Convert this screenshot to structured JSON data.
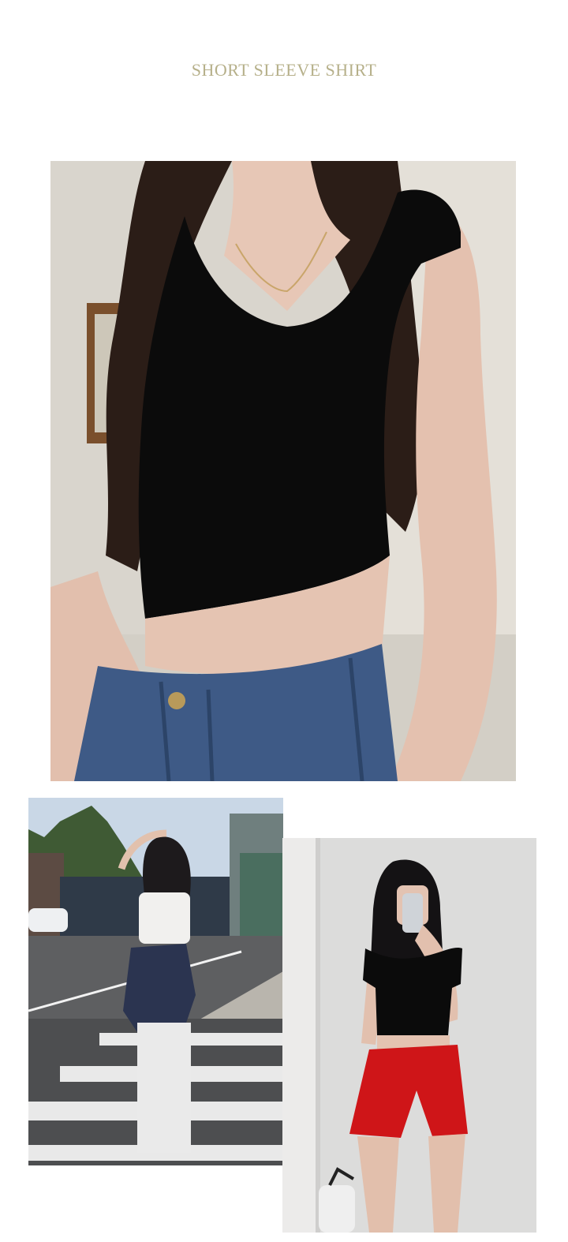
{
  "page": {
    "title": "SHORT SLEEVE SHIRT"
  },
  "colors": {
    "title": "#b6b08a",
    "top_black": "#0b0b0b",
    "denim": "#3e5a86",
    "shorts_red": "#cf1518",
    "sky": "#c9d7e6"
  },
  "images": [
    {
      "name": "main-photo",
      "alt": "model wearing black sleeveless crop top with denim jeans"
    },
    {
      "name": "street-photo",
      "alt": "model in white crop top and white pants on street crosswalk"
    },
    {
      "name": "studio-photo",
      "alt": "model in black crop top and red shorts taking mirror selfie"
    }
  ]
}
